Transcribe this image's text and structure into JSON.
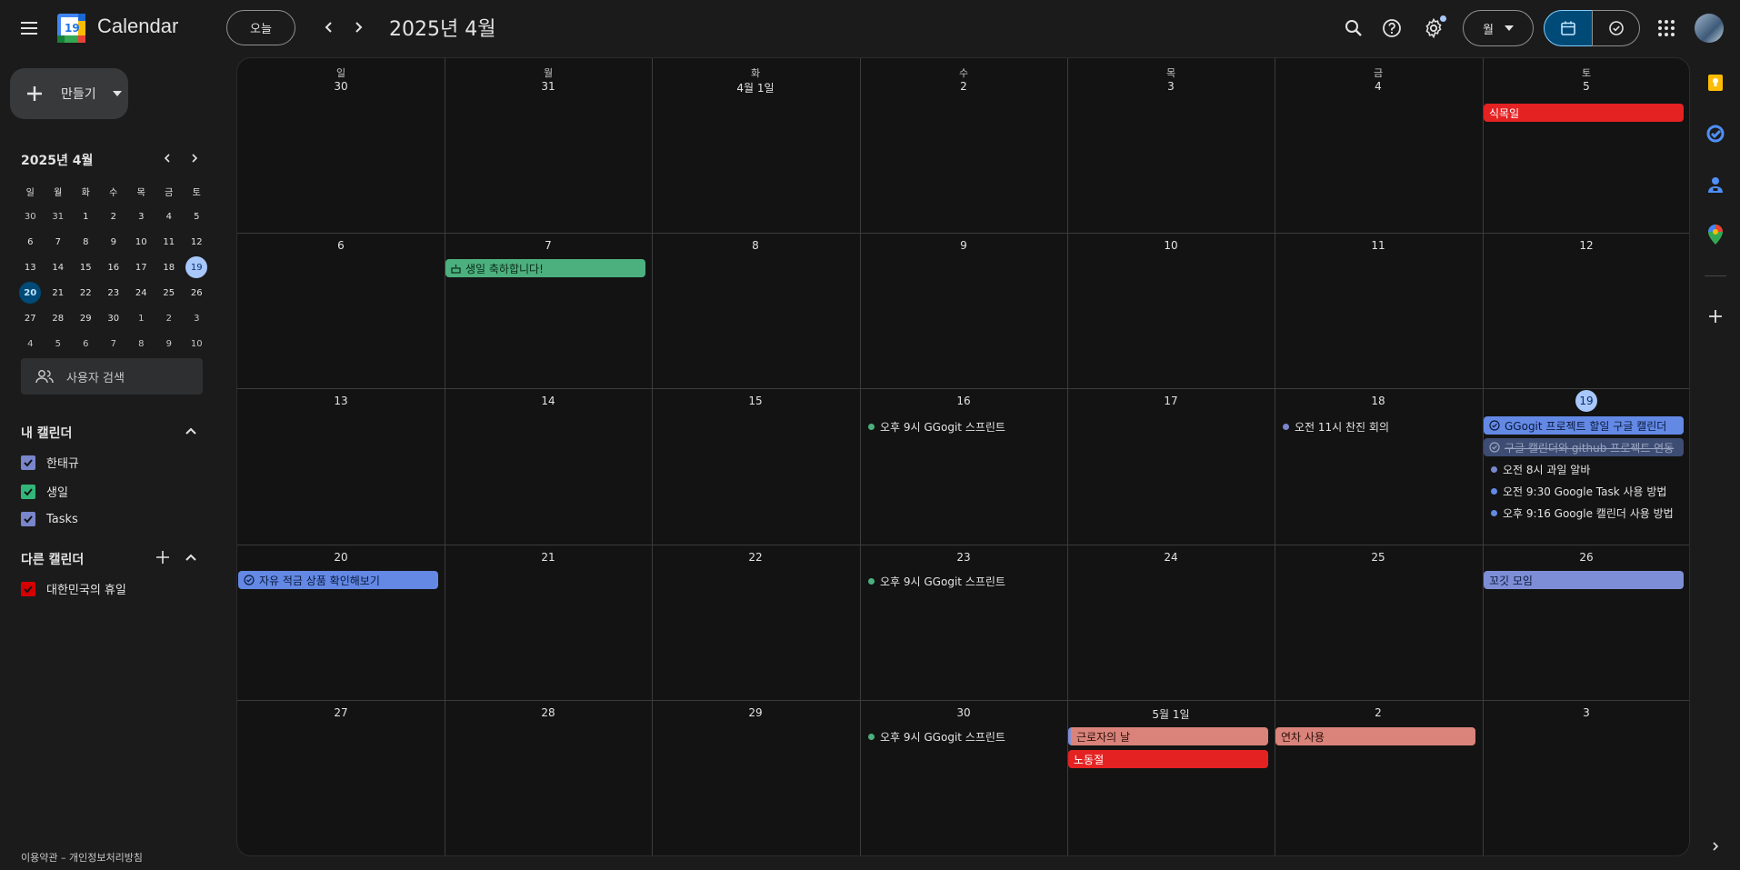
{
  "header": {
    "app_name": "Calendar",
    "logo_day": "19",
    "today_label": "오늘",
    "period_title": "2025년 4월",
    "view_label": "월"
  },
  "sidebar": {
    "create_label": "만들기",
    "mini_title": "2025년 4월",
    "mini_dow": [
      "일",
      "월",
      "화",
      "수",
      "목",
      "금",
      "토"
    ],
    "mini_days": [
      "30",
      "31",
      "1",
      "2",
      "3",
      "4",
      "5",
      "6",
      "7",
      "8",
      "9",
      "10",
      "11",
      "12",
      "13",
      "14",
      "15",
      "16",
      "17",
      "18",
      "19",
      "20",
      "21",
      "22",
      "23",
      "24",
      "25",
      "26",
      "27",
      "28",
      "29",
      "30",
      "1",
      "2",
      "3",
      "4",
      "5",
      "6",
      "7",
      "8",
      "9",
      "10"
    ],
    "people_search": "사용자 검색",
    "my_calendars_title": "내 캘린더",
    "my_calendars": [
      {
        "label": "한태규",
        "color": "#7986cb"
      },
      {
        "label": "생일",
        "color": "#33b679"
      },
      {
        "label": "Tasks",
        "color": "#7986cb"
      }
    ],
    "other_calendars_title": "다른 캘린더",
    "other_calendars": [
      {
        "label": "대한민국의 휴일",
        "color": "#d50000"
      }
    ],
    "footer": "이용약관 – 개인정보처리방침"
  },
  "month": {
    "dow": [
      "일",
      "월",
      "화",
      "수",
      "목",
      "금",
      "토"
    ],
    "weeks": [
      [
        "30",
        "31",
        "4월 1일",
        "2",
        "3",
        "4",
        "5"
      ],
      [
        "6",
        "7",
        "8",
        "9",
        "10",
        "11",
        "12"
      ],
      [
        "13",
        "14",
        "15",
        "16",
        "17",
        "18",
        "19"
      ],
      [
        "20",
        "21",
        "22",
        "23",
        "24",
        "25",
        "26"
      ],
      [
        "27",
        "28",
        "29",
        "30",
        "5월 1일",
        "2",
        "3"
      ]
    ],
    "events": {
      "sikmogil": "식목일",
      "birthday": "생일 축하합니다!",
      "sprint1": "오후 9시 GGogit 스프린트",
      "meeting": "오전 11시 찬진 회의",
      "task1": "GGogit 프로젝트 할일 구글 캘린더",
      "task2": "구글 캘린더와 github 프로젝트 연동",
      "fruit": "오전 8시 과일 알바",
      "task3": "오전 9:30  Google Task 사용 방법",
      "task4": "오후 9:16  Google 캘린더 사용 방법",
      "savings": "자유 적금 상품 확인해보기",
      "sprint2": "오후 9시 GGogit 스프린트",
      "meetup": "꼬깃 모임",
      "sprint3": "오후 9시 GGogit 스프린트",
      "workers": "근로자의 날",
      "labor": "노동절",
      "leave": "연차 사용"
    }
  },
  "colors": {
    "holiday": "#e52222",
    "birthday": "#4caf7e",
    "task_blue": "#6489e5",
    "lavender": "#7e8ed6",
    "flamingo": "#d9837a",
    "event_dot": "#7986cb",
    "sprint_dot": "#4caf7e"
  }
}
